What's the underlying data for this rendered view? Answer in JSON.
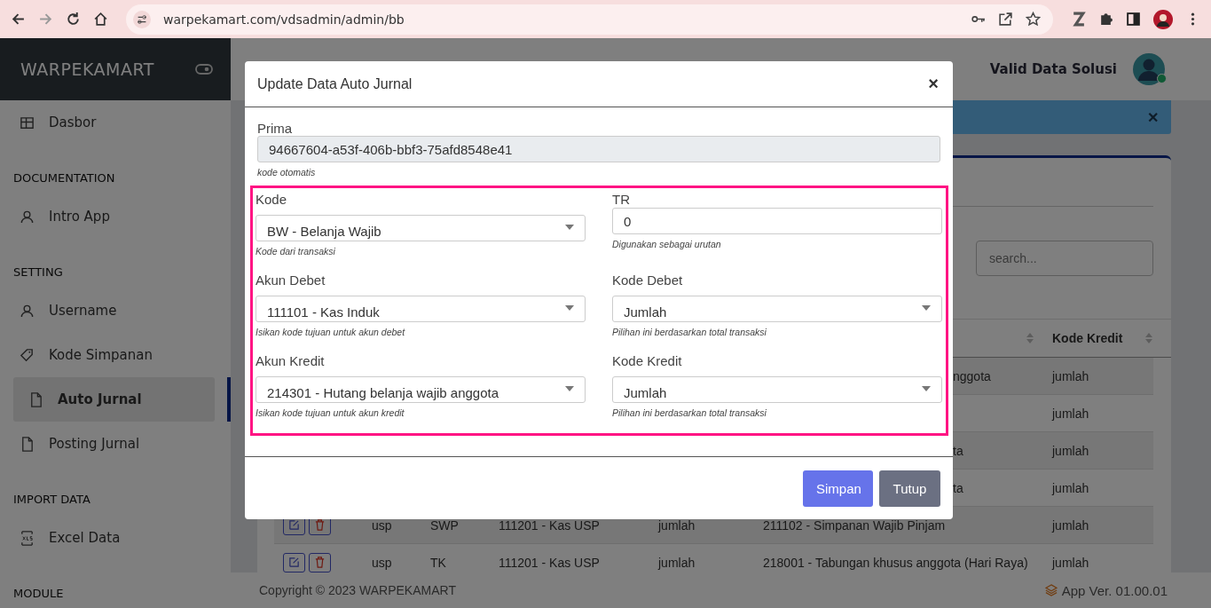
{
  "browser": {
    "url": "warpekamart.com/vdsadmin/admin/bb"
  },
  "sidebar": {
    "brand": "WARPEKAMART",
    "groups": [
      {
        "items": [
          {
            "label": "Dasbor",
            "selected": false
          }
        ]
      },
      {
        "heading": "DOCUMENTATION",
        "items": [
          {
            "label": "Intro App",
            "selected": false
          }
        ]
      },
      {
        "heading": "SETTING",
        "items": [
          {
            "label": "Username",
            "selected": false
          },
          {
            "label": "Kode Simpanan",
            "selected": false
          },
          {
            "label": "Auto Jurnal",
            "selected": true
          },
          {
            "label": "Posting Jurnal",
            "selected": false
          }
        ]
      },
      {
        "heading": "IMPORT DATA",
        "items": [
          {
            "label": "Excel Data",
            "selected": false
          }
        ]
      },
      {
        "heading": "MODULE"
      }
    ]
  },
  "topbar": {
    "user": "Valid Data Solusi",
    "online": true
  },
  "alert": {
    "close": "✕"
  },
  "table": {
    "search": {
      "placeholder": "search..."
    },
    "last_column": "Kode Kredit",
    "rows": [
      {
        "cut": true,
        "akun_kredit": "nggota",
        "kode_kredit": "jumlah"
      },
      {
        "kode_kredit": "jumlah"
      },
      {
        "cut": true,
        "akun_kredit": "ta",
        "kode_kredit": "jumlah"
      },
      {
        "cut": true,
        "akun_kredit": "ta",
        "kode_kredit": "jumlah"
      },
      {
        "cut": false,
        "kelompok": "usp",
        "kode": "SWP",
        "akun_debet": "111201 - Kas USP",
        "kode_debet": "jumlah",
        "akun_kredit": "211102 - Simpanan Wajib Pinjam",
        "kode_kredit": "jumlah"
      },
      {
        "cut": false,
        "kelompok": "usp",
        "kode": "TK",
        "akun_debet": "111201 - Kas USP",
        "kode_debet": "jumlah",
        "akun_kredit": "218001 - Tabungan khusus anggota (Hari Raya)",
        "kode_kredit": "jumlah"
      }
    ]
  },
  "footer": {
    "copyright": "Copyright © 2023 WARPEKAMART",
    "version": "App Ver. 01.00.01"
  },
  "modal": {
    "title": "Update Data Auto Jurnal",
    "close": "×",
    "prima": {
      "label": "Prima",
      "kind": "readonly",
      "value": "94667604-a53f-406b-bbf3-75afd8548e41",
      "help": "kode otomatis"
    },
    "fields": [
      {
        "label": "Kode",
        "kind": "select",
        "value": "BW - Belanja Wajib",
        "help": "Kode dari transaksi"
      },
      {
        "label": "TR",
        "kind": "input",
        "value": "0",
        "help": "Digunakan sebagai urutan"
      },
      {
        "label": "Akun Debet",
        "kind": "select",
        "value": "111101 - Kas Induk",
        "help": "Isikan kode tujuan untuk akun debet"
      },
      {
        "label": "Kode Debet",
        "kind": "select",
        "value": "Jumlah",
        "help": "Pilihan ini berdasarkan total transaksi"
      },
      {
        "label": "Akun Kredit",
        "kind": "select",
        "value": "214301 - Hutang belanja wajib anggota",
        "help": "Isikan kode tujuan untuk akun kredit"
      },
      {
        "label": "Kode Kredit",
        "kind": "select",
        "value": "Jumlah",
        "help": "Pilihan ini berdasarkan total transaksi"
      }
    ],
    "buttons": [
      {
        "label": "Simpan",
        "kind": "primary"
      },
      {
        "label": "Tutup",
        "kind": "secondary"
      }
    ]
  }
}
